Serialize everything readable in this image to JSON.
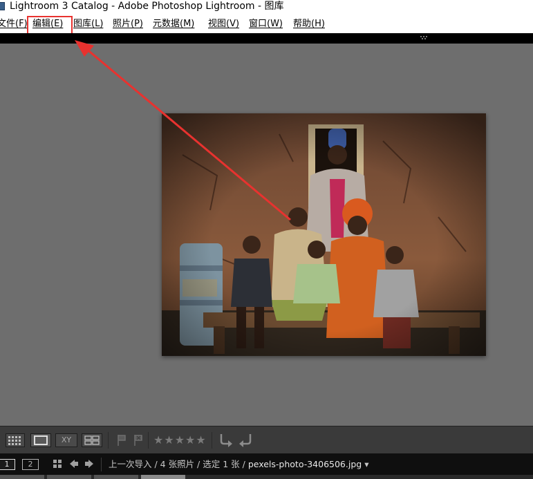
{
  "window": {
    "title": "Lightroom 3 Catalog - Adobe Photoshop Lightroom - 图库"
  },
  "menu": {
    "items": [
      {
        "label": "文件(F)"
      },
      {
        "label": "编辑(E)"
      },
      {
        "label": "图库(L)"
      },
      {
        "label": "照片(P)"
      },
      {
        "label": "元数据(M)"
      },
      {
        "label": "视图(V)"
      },
      {
        "label": "窗口(W)"
      },
      {
        "label": "帮助(H)"
      }
    ],
    "highlighted": "编辑(E)"
  },
  "annotation": {
    "color": "#e8322f",
    "points_to": "编辑(E)"
  },
  "preview": {
    "image": "family-portrait-photo",
    "view_mode": "loupe"
  },
  "toolbar": {
    "view_modes": [
      "grid-view-icon",
      "loupe-view-icon",
      "compare-view-icon",
      "survey-view-icon"
    ],
    "compare_label": "XY",
    "flags": [
      "pick-flag-icon",
      "reject-flag-icon"
    ],
    "rating": "★★★★★",
    "rotate": [
      "rotate-left-icon",
      "rotate-right-icon"
    ]
  },
  "filmstrip": {
    "page_buttons": [
      "1",
      "2"
    ],
    "source_path": "上一次导入 / 4 张照片 / 选定 1 张 / ",
    "filename": "pexels-photo-3406506.jpg",
    "dropdown_arrow": "▾"
  },
  "colors": {
    "panel_bg": "#6e6e6e",
    "toolbar_bg": "#3a3a3a",
    "filmstrip_bg": "#0f0f0f",
    "accent_red": "#e8322f"
  }
}
